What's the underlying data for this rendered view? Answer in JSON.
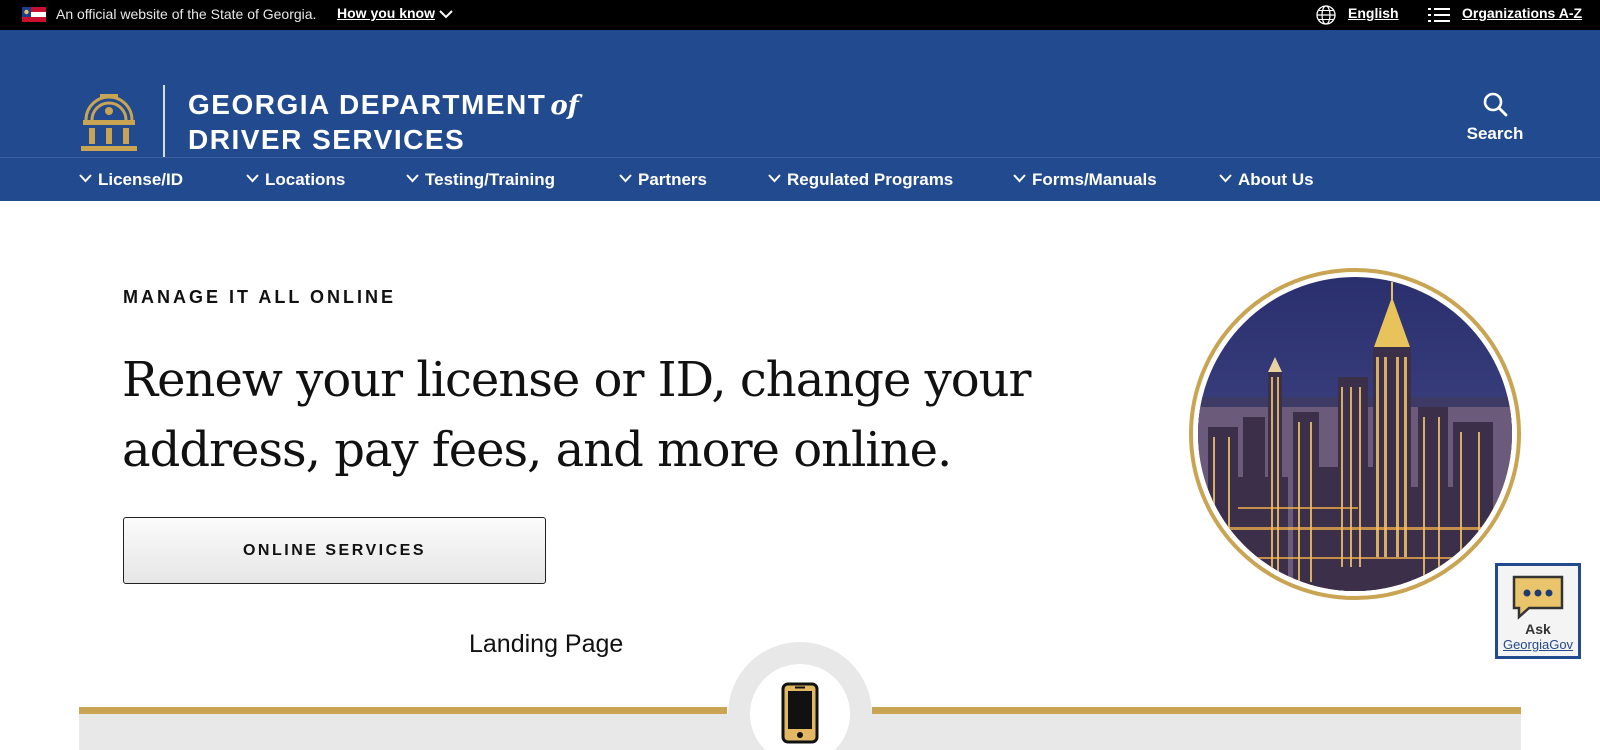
{
  "topbar": {
    "official_text": "An official website of the State of Georgia.",
    "how_you_know": "How you know",
    "language": "English",
    "organizations": "Organizations A-Z"
  },
  "header": {
    "brand_line1": "GEORGIA DEPARTMENT",
    "brand_of": "of",
    "brand_line2": "DRIVER SERVICES",
    "search_label": "Search"
  },
  "nav": {
    "items": [
      {
        "label": "License/ID"
      },
      {
        "label": "Locations"
      },
      {
        "label": "Testing/Training"
      },
      {
        "label": "Partners"
      },
      {
        "label": "Regulated Programs"
      },
      {
        "label": "Forms/Manuals"
      },
      {
        "label": "About Us"
      }
    ]
  },
  "hero": {
    "eyebrow": "MANAGE IT ALL ONLINE",
    "headline": "Renew your license or ID, change your address, pay fees, and more online.",
    "button_label": "ONLINE SERVICES",
    "landing_text": "Landing Page"
  },
  "ask": {
    "line1": "Ask",
    "line2": "GeorgiaGov"
  },
  "colors": {
    "brand_blue": "#224a8f",
    "gold": "#c9a452",
    "topbar": "#000000"
  },
  "icons": [
    "georgia-flag-icon",
    "chevron-down-icon",
    "globe-icon",
    "list-icon",
    "georgia-seal-logo",
    "search-icon",
    "skyline-image",
    "chat-bubble-icon",
    "mobile-phone-icon"
  ]
}
